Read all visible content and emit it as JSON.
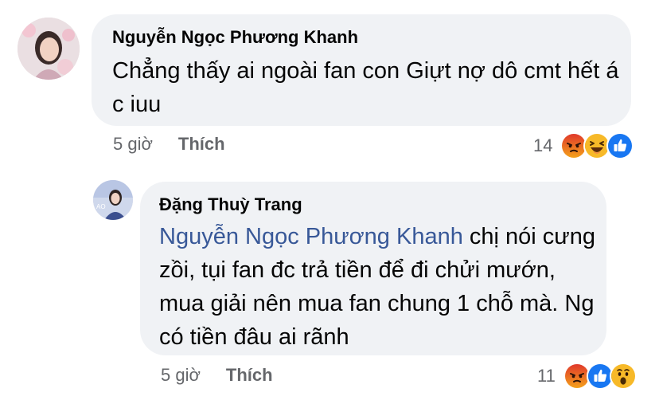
{
  "comments": [
    {
      "author": "Nguyễn Ngọc Phương Khanh",
      "text": "Chẳng thấy ai ngoài fan con Giựt nợ dô cmt hết á c iuu",
      "time": "5 giờ",
      "like_label": "Thích",
      "reaction_count": "14",
      "reactions": [
        "angry-icon",
        "haha-icon",
        "like-icon"
      ]
    },
    {
      "author": "Đặng Thuỳ Trang",
      "mention": "Nguyễn Ngọc Phương Khanh",
      "text": " chị nói cưng zồi, tụi fan đc trả tiền để đi chửi mướn, mua giải nên mua fan chung 1 chỗ mà. Ng có tiền đâu ai rãnh",
      "time": "5 giờ",
      "like_label": "Thích",
      "reaction_count": "11",
      "reactions": [
        "angry-icon",
        "like-icon",
        "wow-icon"
      ]
    }
  ],
  "colors": {
    "bubble": "#f0f2f5",
    "mention": "#385898",
    "meta": "#65676b",
    "like_blue": "#1877f2",
    "angry": "#e9710f",
    "haha_yellow": "#f7b928"
  }
}
